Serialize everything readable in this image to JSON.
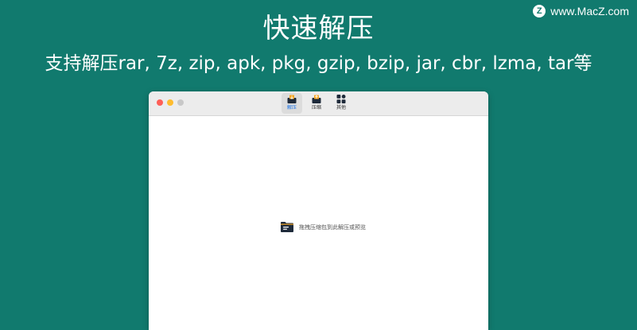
{
  "banner": {
    "title": "快速解压",
    "subtitle": "支持解压rar, 7z, zip, apk, pkg, gzip, bzip, jar, cbr, lzma, tar等"
  },
  "watermark": {
    "logo_letter": "Z",
    "text": "www.MacZ.com"
  },
  "window": {
    "traffic_lights": [
      "close",
      "minimize",
      "zoom"
    ],
    "tabs": [
      {
        "label": "解压",
        "icon": "extract-tray-icon",
        "active": true
      },
      {
        "label": "压缩",
        "icon": "compress-tray-icon",
        "active": false
      },
      {
        "label": "其他",
        "icon": "grid-apps-icon",
        "active": false
      }
    ],
    "dropzone": {
      "icon": "folder-archive-icon",
      "text": "拖拽压缩包到此解压或预览"
    }
  },
  "colors": {
    "background": "#117A6E",
    "accent": "#1a73e8",
    "icon_dark": "#1e2a3a",
    "icon_orange": "#f5a623"
  }
}
